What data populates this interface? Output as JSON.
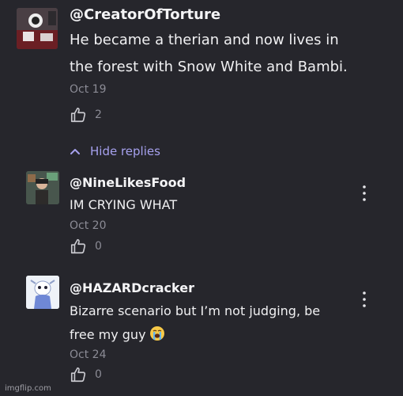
{
  "comments": [
    {
      "username": "@CreatorOfTorture",
      "lines": [
        "He became a therian and now lives in",
        "the forest with Snow White and Bambi."
      ],
      "date": "Oct 19",
      "likes": "2",
      "avatar_icon": "profile-picture"
    }
  ],
  "hide_replies": {
    "label": "Hide replies",
    "icon": "chevron-up-icon"
  },
  "replies": [
    {
      "username": "@NineLikesFood",
      "text": "IM CRYING WHAT",
      "date": "Oct 20",
      "likes": "0",
      "avatar_icon": "profile-picture"
    },
    {
      "username": "@HAZARDcracker",
      "lines": [
        "Bizarre scenario but I’m not judging, be",
        "free my guy"
      ],
      "emoji": "loudly-crying-face-emoji",
      "date": "Oct 24",
      "likes": "0",
      "avatar_icon": "profile-picture"
    }
  ],
  "watermark": "imgflip.com",
  "colors": {
    "background": "#26262c",
    "accent": "#a6a1ee",
    "muted": "#8b8b95"
  }
}
